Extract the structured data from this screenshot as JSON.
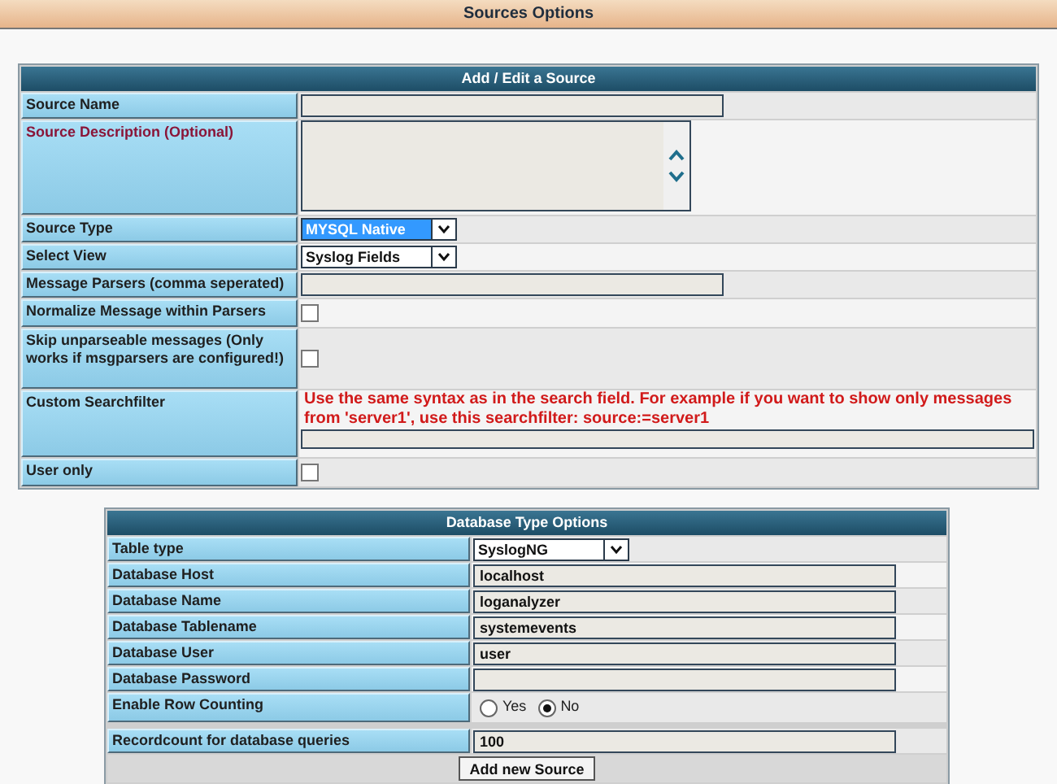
{
  "page_title": "Sources Options",
  "source_form": {
    "title": "Add / Edit a Source",
    "rows": [
      {
        "kind": "text",
        "label": "Source Name",
        "color": "#1f1f1f"
      },
      {
        "kind": "textarea",
        "label": "Source Description (Optional)",
        "color": "#8a1538"
      },
      {
        "kind": "select",
        "label": "Source Type",
        "color": "#1f1f1f",
        "value": "MYSQL Native",
        "focused": true
      },
      {
        "kind": "select",
        "label": "Select View",
        "color": "#1f1f1f",
        "value": "Syslog Fields",
        "focused": false
      },
      {
        "kind": "text",
        "label": "Message Parsers (comma seperated)",
        "color": "#1f1f1f"
      },
      {
        "kind": "checkbox",
        "label": "Normalize Message within Parsers",
        "color": "#1f1f1f",
        "checked": false
      },
      {
        "kind": "checkbox",
        "label": "Skip unparseable messages (Only works if msgparsers are configured!)",
        "color": "#1f1f1f",
        "checked": false
      },
      {
        "kind": "searchfilter",
        "label": "Custom Searchfilter",
        "color": "#1f1f1f",
        "note": "Use the same syntax as in the search field. For example if you want to show only messages from 'server1', use this searchfilter: source:=server1"
      },
      {
        "kind": "checkbox",
        "label": "User only",
        "color": "#1f1f1f",
        "checked": false
      }
    ]
  },
  "database_options": {
    "title": "Database Type Options",
    "rows": [
      {
        "kind": "select",
        "label": "Table type",
        "value": "SyslogNG",
        "focused": false
      },
      {
        "kind": "text",
        "label": "Database Host",
        "value": "localhost"
      },
      {
        "kind": "text",
        "label": "Database Name",
        "value": "loganalyzer"
      },
      {
        "kind": "text",
        "label": "Database Tablename",
        "value": "systemevents"
      },
      {
        "kind": "text",
        "label": "Database User",
        "value": "user"
      },
      {
        "kind": "text",
        "label": "Database Password"
      },
      {
        "kind": "radio",
        "label": "Enable Row Counting",
        "options": [
          {
            "label": "Yes",
            "selected": false
          },
          {
            "label": "No",
            "selected": true
          }
        ]
      }
    ],
    "recordcount": {
      "label": "Recordcount for database queries",
      "value": "100"
    },
    "submit_button": "Add new Source"
  }
}
